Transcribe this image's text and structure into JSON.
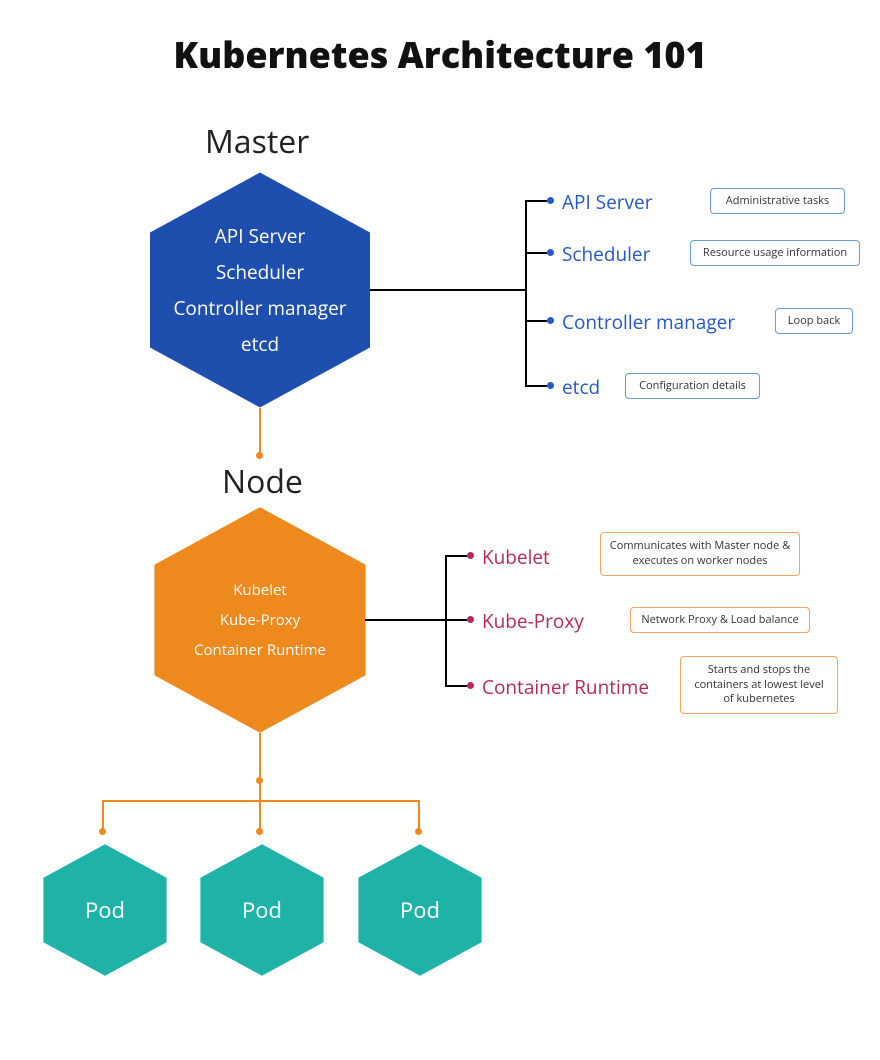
{
  "title": "Kubernetes Architecture 101",
  "colors": {
    "master_hex": "#1f4fae",
    "node_hex": "#ee8a1d",
    "pod_hex": "#1fb3a7",
    "master_branch_text": "#2558c9",
    "node_branch_text": "#b62a5b",
    "master_box_border": "#6b9bd8",
    "node_box_border": "#f2a35e"
  },
  "master": {
    "label": "Master",
    "components": [
      "API Server",
      "Scheduler",
      "Controller manager",
      "etcd"
    ],
    "branches": [
      {
        "name": "API Server",
        "desc": "Administrative tasks"
      },
      {
        "name": "Scheduler",
        "desc": "Resource usage information"
      },
      {
        "name": "Controller manager",
        "desc": "Loop back"
      },
      {
        "name": "etcd",
        "desc": "Configuration details"
      }
    ]
  },
  "node": {
    "label": "Node",
    "components": [
      "Kubelet",
      "Kube-Proxy",
      "Container Runtime"
    ],
    "branches": [
      {
        "name": "Kubelet",
        "desc": "Communicates with Master node & executes on worker nodes"
      },
      {
        "name": "Kube-Proxy",
        "desc": "Network Proxy & Load balance"
      },
      {
        "name": "Container Runtime",
        "desc": "Starts and stops the containers at lowest level of kubernetes"
      }
    ]
  },
  "pods": [
    "Pod",
    "Pod",
    "Pod"
  ]
}
